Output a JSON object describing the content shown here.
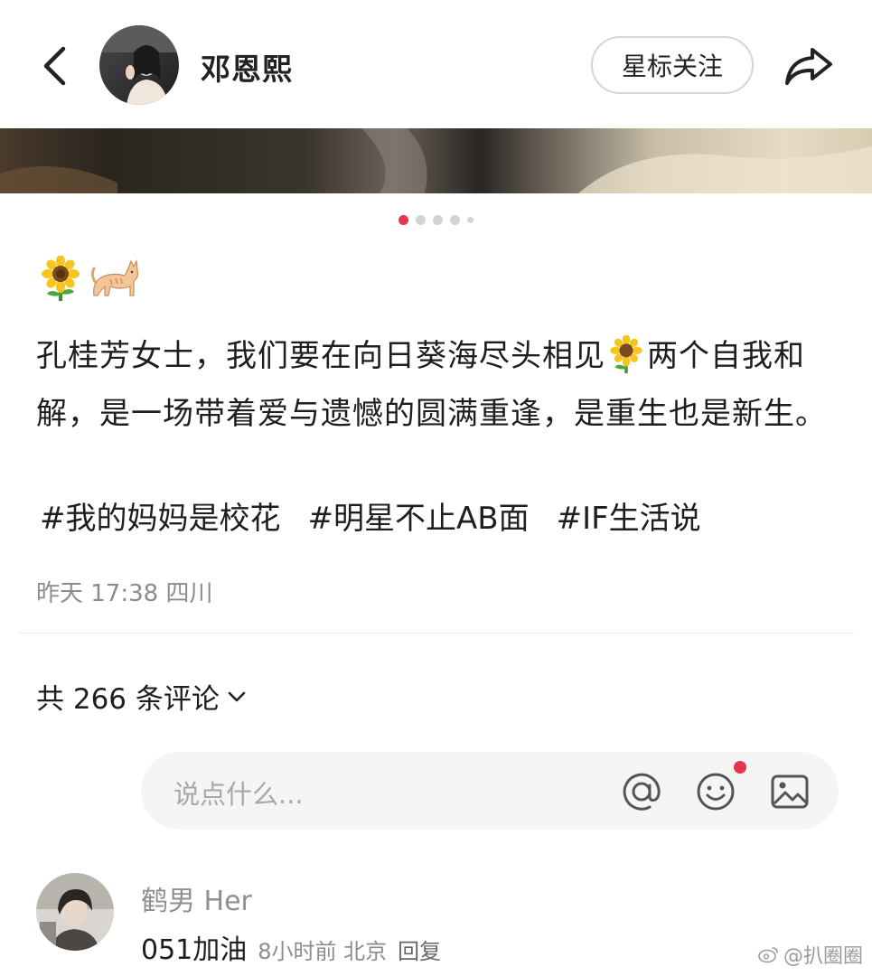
{
  "header": {
    "username": "邓恩熙",
    "follow_label": "星标关注"
  },
  "carousel": {
    "total_slides": 5,
    "active_index": 0
  },
  "post": {
    "emojis": [
      "sunflower-emoji",
      "cat-emoji"
    ],
    "text_part1": "孔桂芳女士，我们要在向日葵海尽头相见",
    "text_part2": "两个自我和解，是一场带着爱与遗憾的圆满重逢，是重生也是新生。",
    "tags": [
      "#我的妈妈是校花",
      "#明星不止AB面",
      "#IF生活说"
    ],
    "meta": "昨天 17:38 四川"
  },
  "comments_section": {
    "count_label": "共 266 条评论",
    "input_placeholder": "说点什么...",
    "icons": [
      "at-icon",
      "emoji-face-icon",
      "image-icon"
    ]
  },
  "comments": [
    {
      "author": "鹤男 Her",
      "text": "051加油",
      "meta": "8小时前 北京",
      "reply_label": "回复"
    }
  ],
  "watermark": "@扒圈圈",
  "colors": {
    "accent": "#e8344e",
    "secondary_text": "#8c8c8c",
    "input_bg": "#f5f5f5"
  }
}
